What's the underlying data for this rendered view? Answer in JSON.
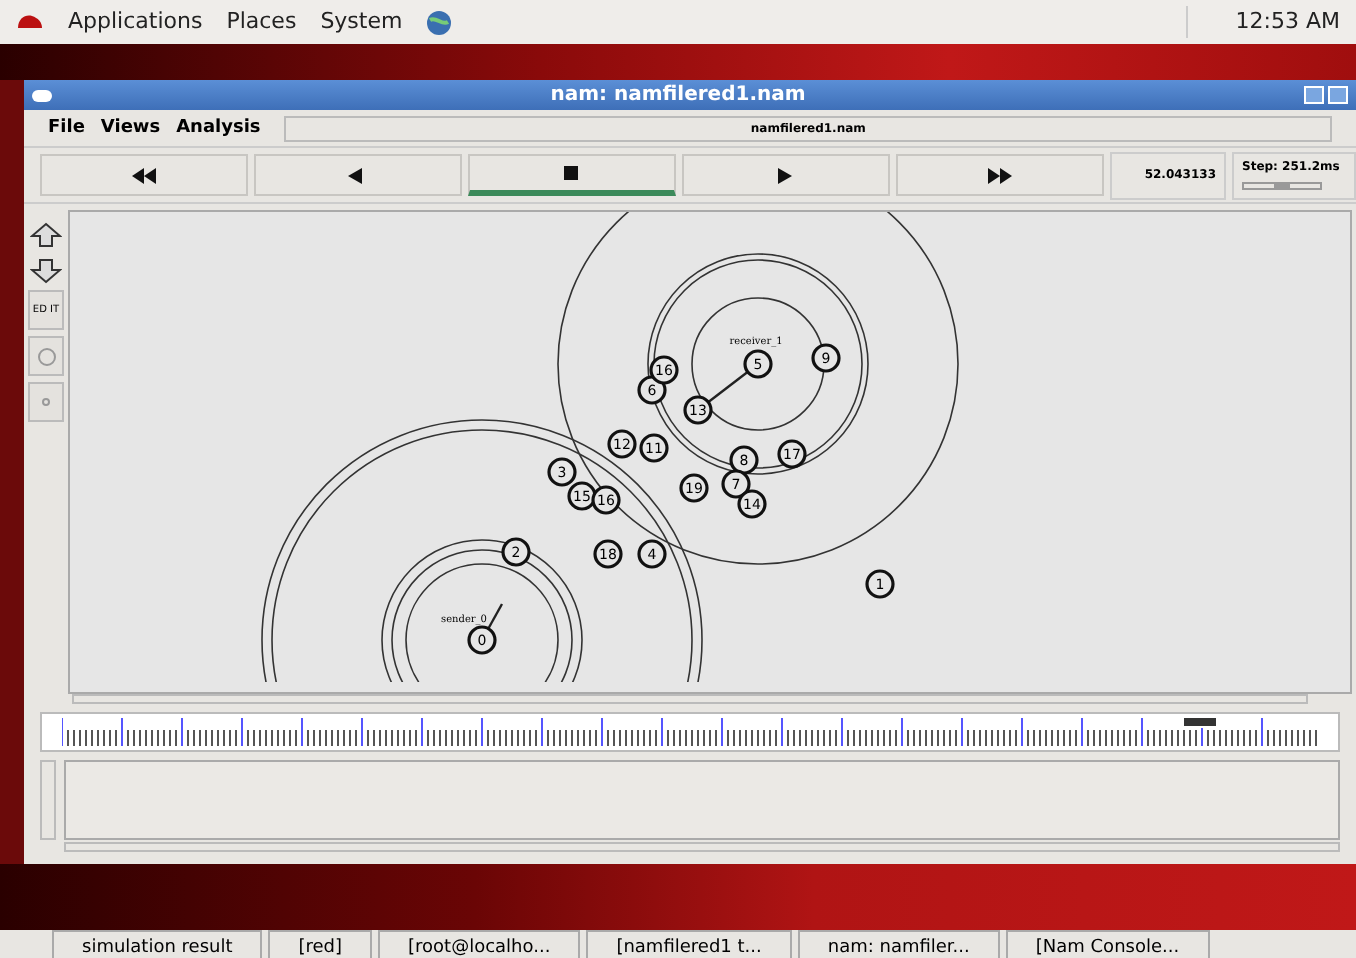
{
  "top_panel": {
    "menus": [
      "Applications",
      "Places",
      "System"
    ],
    "clock": "12:53 AM"
  },
  "window": {
    "title": "nam: namfilered1.nam"
  },
  "menu": [
    "File",
    "Views",
    "Analysis"
  ],
  "file_label": "namfilered1.nam",
  "controls": [
    {
      "kind": "rewind",
      "selected": false
    },
    {
      "kind": "back",
      "selected": false
    },
    {
      "kind": "stop",
      "selected": true
    },
    {
      "kind": "play",
      "selected": false
    },
    {
      "kind": "forward",
      "selected": false
    }
  ],
  "time": "52.043133",
  "step": {
    "text": "Step: 251.2ms",
    "level": 0.5
  },
  "tools": [
    {
      "kind": "zoom-in"
    },
    {
      "kind": "zoom-out"
    },
    {
      "kind": "edit",
      "label": "ED IT"
    },
    {
      "kind": "circle"
    },
    {
      "kind": "dot"
    }
  ],
  "canvas": {
    "labels": [
      "sender_0",
      "receiver_1"
    ],
    "nodes": [
      "0",
      "2",
      "18",
      "4",
      "3",
      "15",
      "16",
      "12",
      "11",
      "19",
      "13",
      "6",
      "16",
      "5",
      "9",
      "8",
      "17",
      "7",
      "14",
      "1"
    ]
  },
  "taskbar": [
    "simulation result",
    "[red]",
    "[root@localho...",
    "[namfilered1 t...",
    "nam: namfiler...",
    "[Nam Console..."
  ]
}
